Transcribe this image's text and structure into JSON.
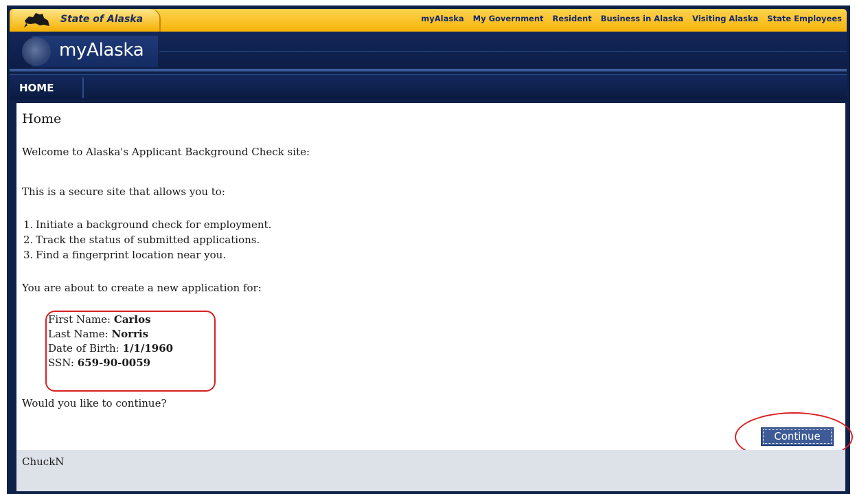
{
  "header": {
    "state_logo_text": "State of Alaska",
    "brand": "myAlaska",
    "nav": [
      "myAlaska",
      "My Government",
      "Resident",
      "Business in Alaska",
      "Visiting Alaska",
      "State Employees"
    ]
  },
  "menu": {
    "home": "HOME"
  },
  "main": {
    "title": "Home",
    "welcome": "Welcome to Alaska's Applicant Background Check site:",
    "intro": "This is a secure site that allows you to:",
    "items": [
      "Initiate a background check for employment.",
      "Track the status of submitted applications.",
      "Find a fingerprint location near you."
    ],
    "about": "You are about to create a new application for:",
    "applicant": {
      "first_name_label": "First Name:",
      "first_name": "Carlos",
      "last_name_label": "Last Name:",
      "last_name": "Norris",
      "dob_label": "Date of Birth:",
      "dob": "1/1/1960",
      "ssn_label": "SSN:",
      "ssn": "659-90-0059"
    },
    "question": "Would you like to continue?",
    "continue_label": "Continue"
  },
  "footer": {
    "user": "ChuckN"
  },
  "colors": {
    "gold": "#f6b40a",
    "navy": "#0e2148",
    "highlight": "#d92020",
    "button": "#3e5b98"
  }
}
